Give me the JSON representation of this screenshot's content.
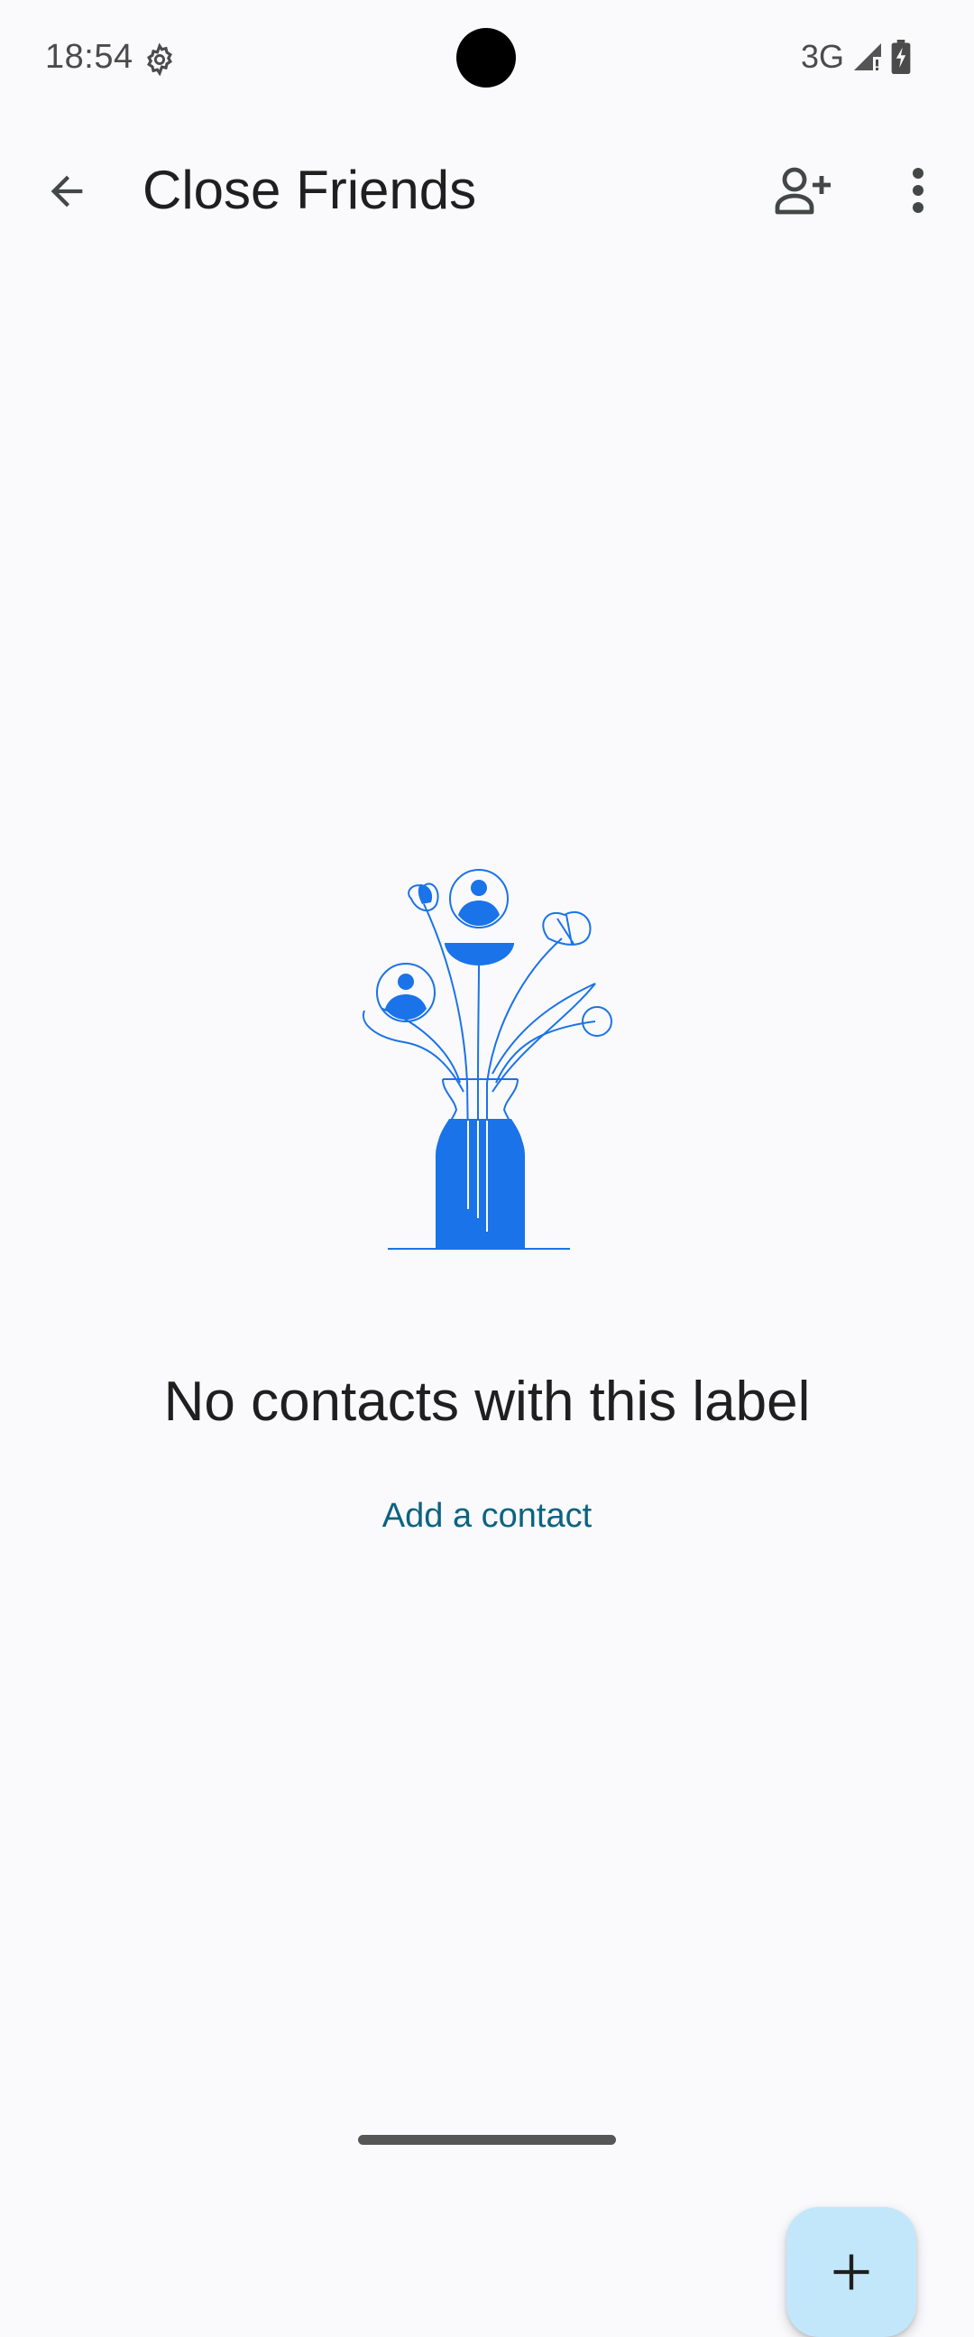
{
  "status_bar": {
    "time": "18:54",
    "network": "3G",
    "icons": [
      "gear-icon",
      "signal-icon",
      "battery-charging-icon"
    ]
  },
  "app_bar": {
    "title": "Close Friends",
    "icons": [
      "arrow-back-icon",
      "person-add-icon",
      "more-vert-icon"
    ]
  },
  "empty_state": {
    "message": "No contacts with this label",
    "action_label": "Add a contact",
    "illustration": "vase-with-flowers-illustration"
  },
  "fab": {
    "icon": "plus-icon"
  },
  "colors": {
    "background": "#fafafd",
    "accent": "#1a73e8",
    "fab": "#c2e7fb",
    "link": "#0b6380"
  }
}
